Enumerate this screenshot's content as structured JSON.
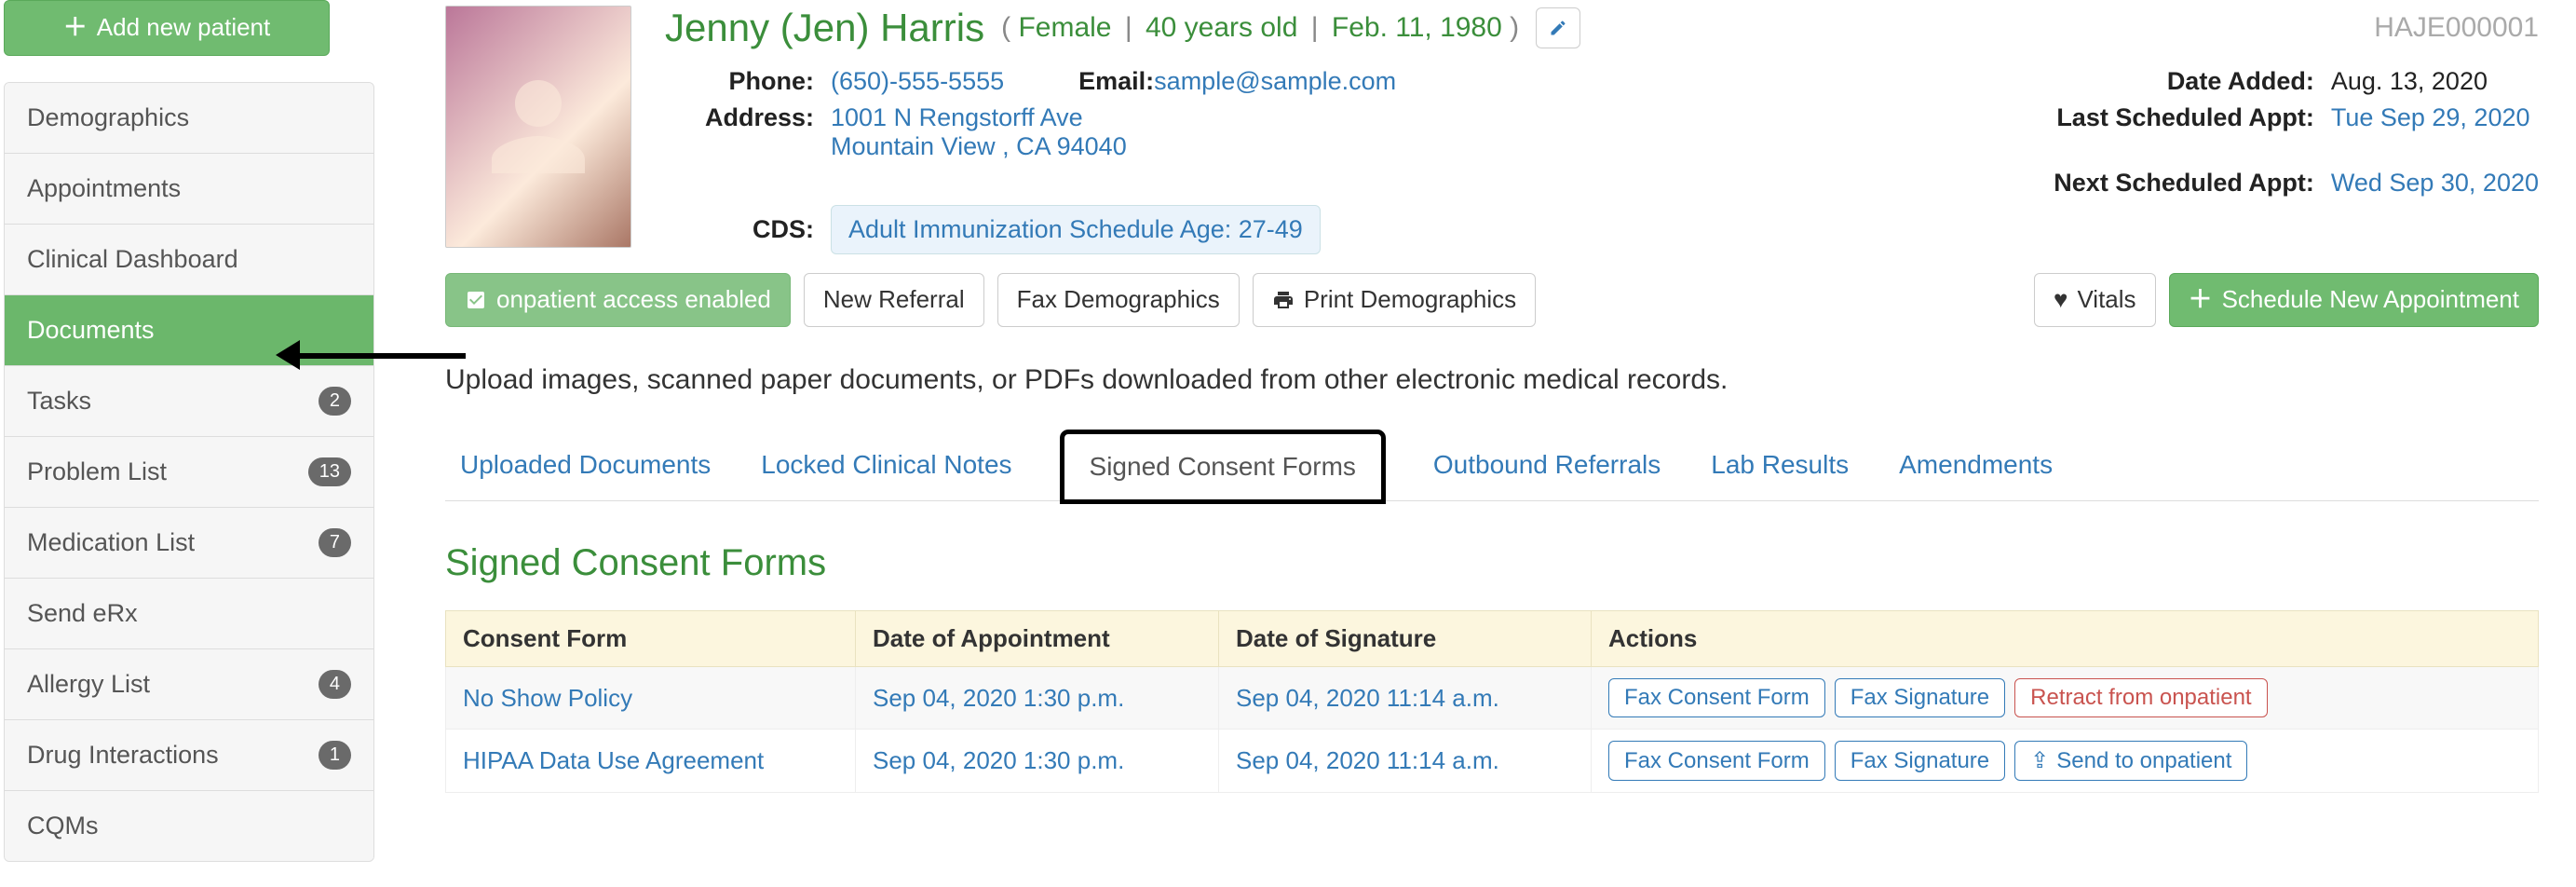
{
  "sidebar": {
    "add_patient_label": "Add new patient",
    "items": [
      {
        "label": "Demographics",
        "badge": null,
        "active": false
      },
      {
        "label": "Appointments",
        "badge": null,
        "active": false
      },
      {
        "label": "Clinical Dashboard",
        "badge": null,
        "active": false
      },
      {
        "label": "Documents",
        "badge": null,
        "active": true
      },
      {
        "label": "Tasks",
        "badge": "2",
        "active": false
      },
      {
        "label": "Problem List",
        "badge": "13",
        "active": false
      },
      {
        "label": "Medication List",
        "badge": "7",
        "active": false
      },
      {
        "label": "Send eRx",
        "badge": null,
        "active": false
      },
      {
        "label": "Allergy List",
        "badge": "4",
        "active": false
      },
      {
        "label": "Drug Interactions",
        "badge": "1",
        "active": false
      },
      {
        "label": "CQMs",
        "badge": null,
        "active": false
      }
    ]
  },
  "patient": {
    "name": "Jenny (Jen) Harris",
    "gender": "Female",
    "age": "40 years old",
    "dob": "Feb. 11, 1980",
    "id": "HAJE000001",
    "phone_label": "Phone:",
    "phone": "(650)-555-5555",
    "email_label": "Email:",
    "email": "sample@sample.com",
    "address_label": "Address:",
    "address_line1": "1001 N Rengstorff Ave",
    "address_line2": "Mountain View , CA 94040",
    "cds_label": "CDS:",
    "cds_value": "Adult Immunization Schedule Age: 27-49",
    "date_added_label": "Date Added:",
    "date_added": "Aug. 13, 2020",
    "last_appt_label": "Last Scheduled Appt:",
    "last_appt": "Tue Sep 29, 2020",
    "next_appt_label": "Next Scheduled Appt:",
    "next_appt": "Wed Sep 30, 2020"
  },
  "actions": {
    "onpatient": "onpatient access enabled",
    "new_referral": "New Referral",
    "fax_demo": "Fax Demographics",
    "print_demo": "Print Demographics",
    "vitals": "Vitals",
    "schedule": "Schedule New Appointment"
  },
  "upload_hint": "Upload images, scanned paper documents, or PDFs downloaded from other electronic medical records.",
  "tabs": [
    {
      "label": "Uploaded Documents",
      "active": false
    },
    {
      "label": "Locked Clinical Notes",
      "active": false
    },
    {
      "label": "Signed Consent Forms",
      "active": true
    },
    {
      "label": "Outbound Referrals",
      "active": false
    },
    {
      "label": "Lab Results",
      "active": false
    },
    {
      "label": "Amendments",
      "active": false
    }
  ],
  "section_title": "Signed Consent Forms",
  "table": {
    "headers": {
      "form": "Consent Form",
      "appt": "Date of Appointment",
      "sig": "Date of Signature",
      "actions": "Actions"
    },
    "rows": [
      {
        "form": "No Show Policy",
        "appt": "Sep 04, 2020 1:30 p.m.",
        "sig": "Sep 04, 2020 11:14 a.m.",
        "actions": {
          "fax_form": "Fax Consent Form",
          "fax_sig": "Fax Signature",
          "third": "Retract from onpatient",
          "third_style": "red",
          "third_icon": false
        }
      },
      {
        "form": "HIPAA Data Use Agreement",
        "appt": "Sep 04, 2020 1:30 p.m.",
        "sig": "Sep 04, 2020 11:14 a.m.",
        "actions": {
          "fax_form": "Fax Consent Form",
          "fax_sig": "Fax Signature",
          "third": "Send to onpatient",
          "third_style": "blue",
          "third_icon": true
        }
      }
    ]
  }
}
